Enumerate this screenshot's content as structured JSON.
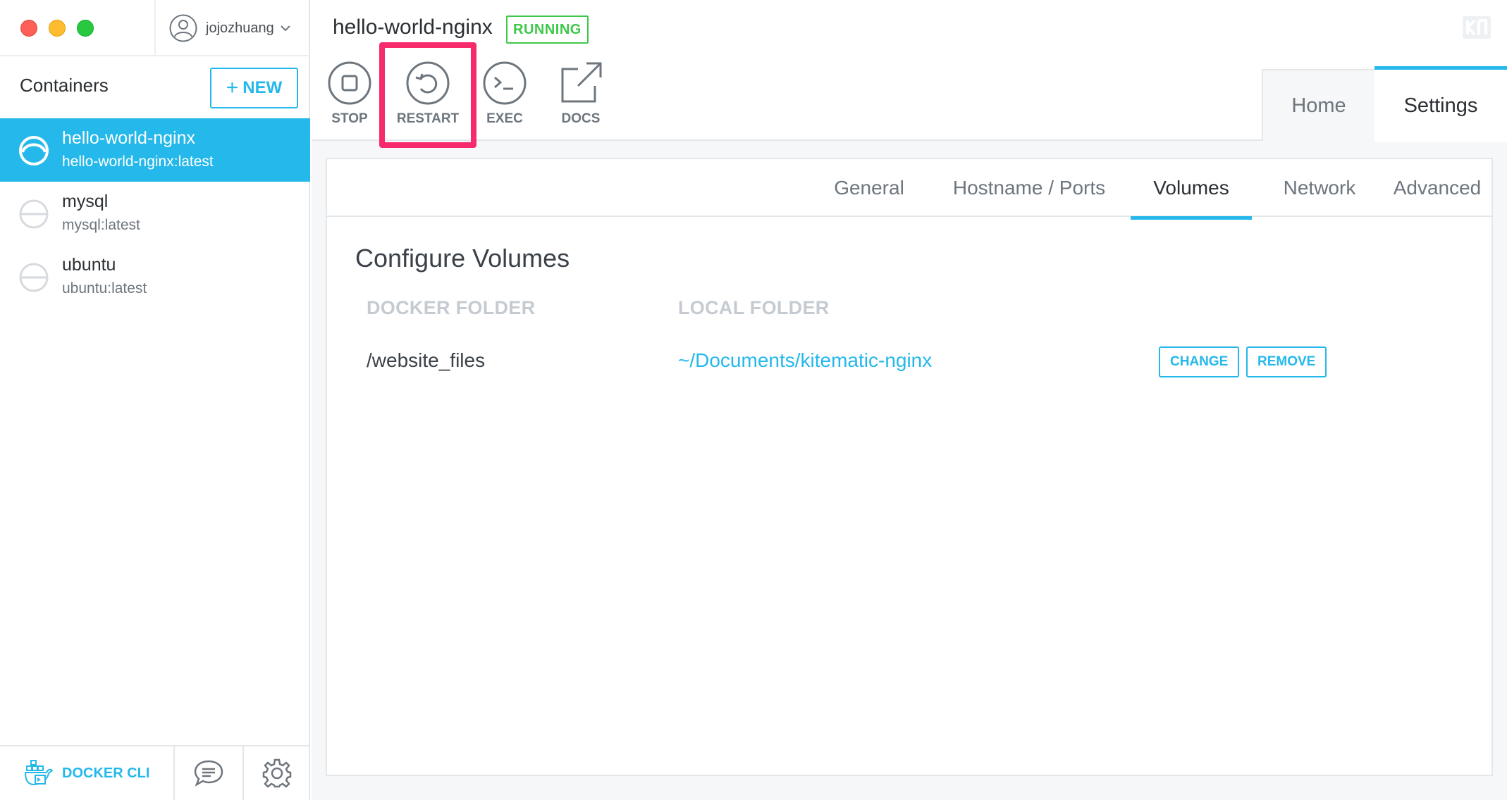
{
  "sidebar": {
    "account": {
      "username": "jojozhuang"
    },
    "heading": "Containers",
    "new_button": {
      "plus": "+",
      "label": "NEW"
    },
    "containers": [
      {
        "name": "hello-world-nginx",
        "image": "hello-world-nginx:latest",
        "active": true
      },
      {
        "name": "mysql",
        "image": "mysql:latest",
        "active": false
      },
      {
        "name": "ubuntu",
        "image": "ubuntu:latest",
        "active": false
      }
    ],
    "footer": {
      "docker_cli_label": "DOCKER CLI"
    }
  },
  "header": {
    "container_title": "hello-world-nginx",
    "status": "RUNNING",
    "actions": [
      {
        "label": "STOP",
        "icon": "stop-icon"
      },
      {
        "label": "RESTART",
        "icon": "restart-icon"
      },
      {
        "label": "EXEC",
        "icon": "terminal-icon"
      },
      {
        "label": "DOCS",
        "icon": "external-link-icon"
      }
    ],
    "tabs": {
      "home": "Home",
      "settings": "Settings"
    }
  },
  "settings": {
    "subtabs": [
      "General",
      "Hostname / Ports",
      "Volumes",
      "Network",
      "Advanced"
    ],
    "active_subtab": "Volumes",
    "volumes": {
      "heading": "Configure Volumes",
      "col_docker": "DOCKER FOLDER",
      "col_local": "LOCAL FOLDER",
      "rows": [
        {
          "docker_folder": "/website_files",
          "local_folder": "~/Documents/kitematic-nginx",
          "change_label": "CHANGE",
          "remove_label": "REMOVE"
        }
      ]
    }
  },
  "colors": {
    "accent": "#24b8eb",
    "running": "#3ec84a",
    "highlight": "#f72a6c"
  }
}
